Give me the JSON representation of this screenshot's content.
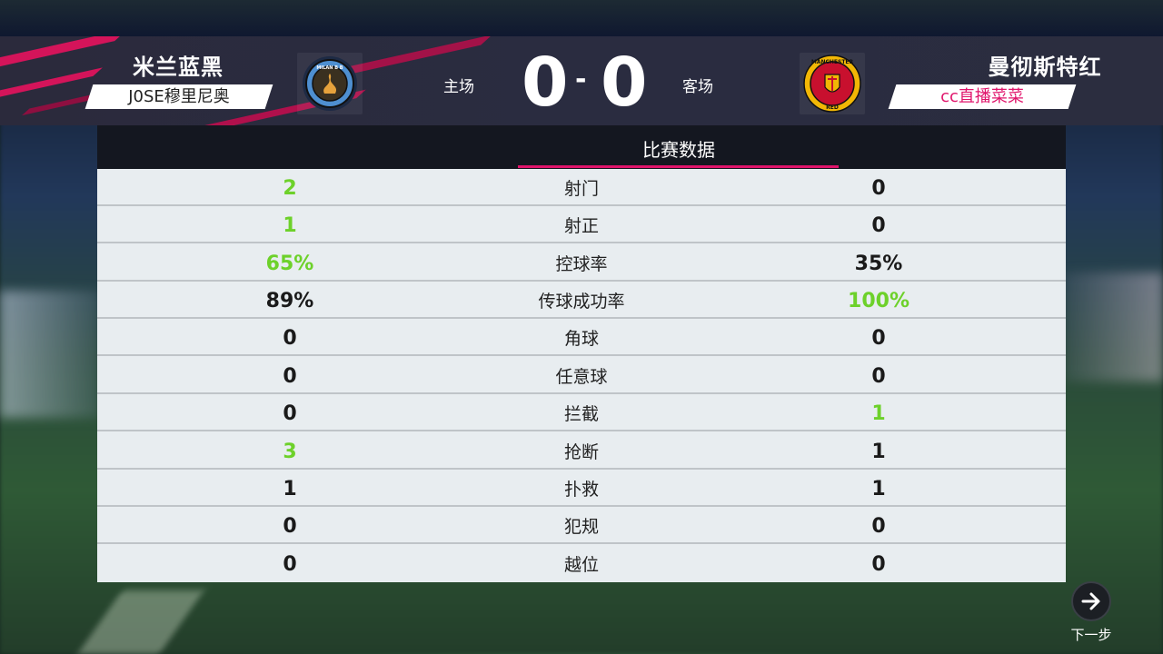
{
  "header": {
    "home_team": "米兰蓝黑",
    "home_user": "J0SE穆里尼奥",
    "away_team": "曼彻斯特红",
    "away_user": "cc直播菜菜",
    "home_side_label": "主场",
    "away_side_label": "客场",
    "home_score": "0",
    "away_score": "0",
    "score_separator": "-",
    "home_crest_text": "MILAN B B",
    "away_crest_text_top": "MANCHESTER",
    "away_crest_text_bottom": "RED"
  },
  "panel": {
    "title": "比赛数据"
  },
  "stats": [
    {
      "label": "射门",
      "home": "2",
      "away": "0",
      "winner": "home"
    },
    {
      "label": "射正",
      "home": "1",
      "away": "0",
      "winner": "home"
    },
    {
      "label": "控球率",
      "home": "65%",
      "away": "35%",
      "winner": "home"
    },
    {
      "label": "传球成功率",
      "home": "89%",
      "away": "100%",
      "winner": "away"
    },
    {
      "label": "角球",
      "home": "0",
      "away": "0",
      "winner": "none"
    },
    {
      "label": "任意球",
      "home": "0",
      "away": "0",
      "winner": "none"
    },
    {
      "label": "拦截",
      "home": "0",
      "away": "1",
      "winner": "away"
    },
    {
      "label": "抢断",
      "home": "3",
      "away": "1",
      "winner": "home"
    },
    {
      "label": "扑救",
      "home": "1",
      "away": "1",
      "winner": "none"
    },
    {
      "label": "犯规",
      "home": "0",
      "away": "0",
      "winner": "none"
    },
    {
      "label": "越位",
      "home": "0",
      "away": "0",
      "winner": "none"
    }
  ],
  "next": {
    "label": "下一步",
    "icon": "arrow-right-icon"
  },
  "colors": {
    "accent": "#e0146b",
    "win": "#6dd12a"
  }
}
